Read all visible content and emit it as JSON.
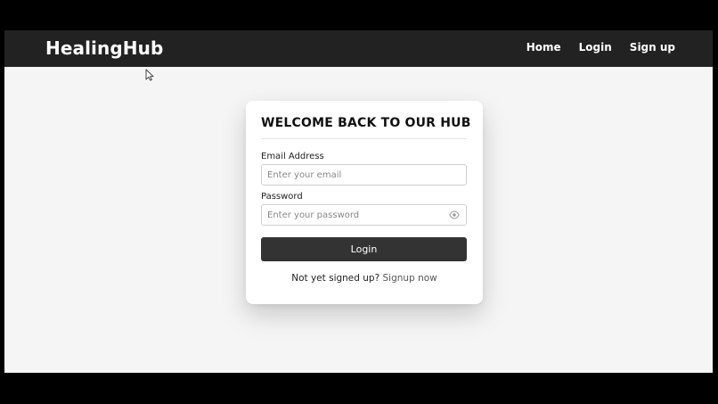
{
  "navbar": {
    "brand": "HealingHub",
    "links": [
      {
        "label": "Home"
      },
      {
        "label": "Login"
      },
      {
        "label": "Sign up"
      }
    ]
  },
  "card": {
    "title": "WELCOME BACK TO OUR HUB",
    "email": {
      "label": "Email Address",
      "placeholder": "Enter your email",
      "value": ""
    },
    "password": {
      "label": "Password",
      "placeholder": "Enter your password",
      "value": ""
    },
    "login_button": "Login",
    "signup_prompt": "Not yet signed up?",
    "signup_link": "Signup now"
  },
  "icons": {
    "eye": "eye-icon",
    "cursor": "mouse-cursor-icon"
  },
  "colors": {
    "navbar_bg": "#222222",
    "page_bg": "#f5f5f5",
    "button_bg": "#333333",
    "card_bg": "#ffffff"
  }
}
